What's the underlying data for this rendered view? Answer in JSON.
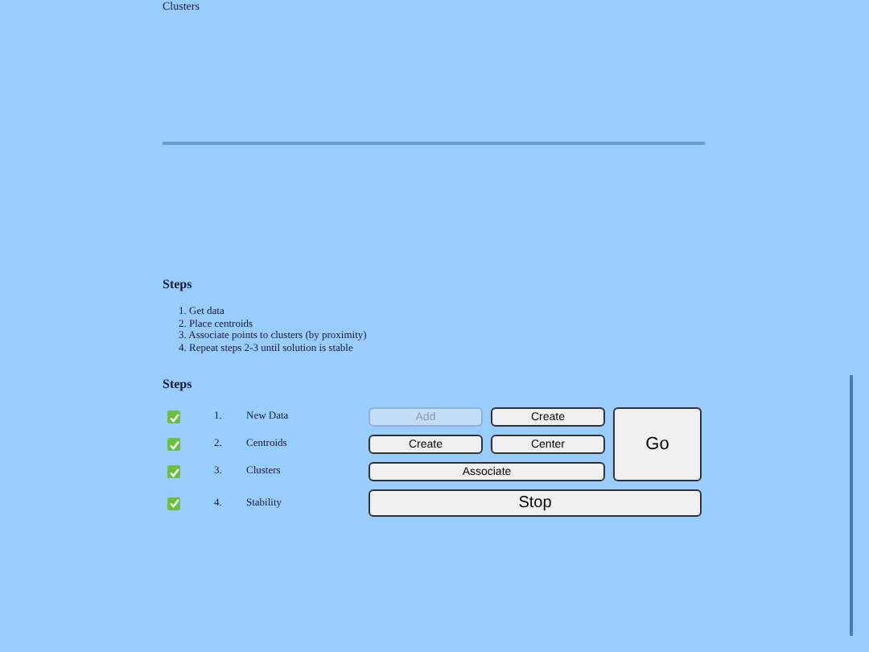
{
  "title": "Clusters",
  "instructions": {
    "heading": "Steps",
    "items": [
      {
        "number": "1.",
        "text": "Get data"
      },
      {
        "number": "2.",
        "text": "Place centroids"
      },
      {
        "number": "3.",
        "text": "Associate points to clusters (by proximity)"
      },
      {
        "number": "4.",
        "text": "Repeat steps 2-3 until solution is stable"
      }
    ]
  },
  "controls": {
    "heading": "Steps",
    "rows": [
      {
        "checked": true,
        "number": "1.",
        "label": "New Data",
        "buttons": [
          {
            "label": "Add",
            "disabled": true
          },
          {
            "label": "Create",
            "disabled": false
          }
        ]
      },
      {
        "checked": true,
        "number": "2.",
        "label": "Centroids",
        "buttons": [
          {
            "label": "Create",
            "disabled": false
          },
          {
            "label": "Center",
            "disabled": false
          }
        ]
      },
      {
        "checked": true,
        "number": "3.",
        "label": "Clusters",
        "buttons": [
          {
            "label": "Associate",
            "disabled": false
          }
        ]
      },
      {
        "checked": true,
        "number": "4.",
        "label": "Stability",
        "buttons": []
      }
    ],
    "go": {
      "label": "Go",
      "disabled": false
    },
    "stop": {
      "label": "Stop",
      "disabled": false
    }
  }
}
